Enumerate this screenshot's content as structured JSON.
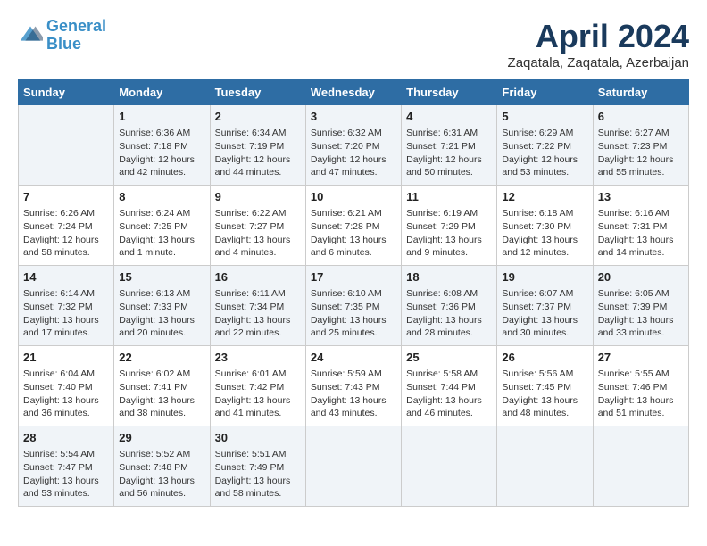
{
  "header": {
    "logo_line1": "General",
    "logo_line2": "Blue",
    "month": "April 2024",
    "location": "Zaqatala, Zaqatala, Azerbaijan"
  },
  "days_of_week": [
    "Sunday",
    "Monday",
    "Tuesday",
    "Wednesday",
    "Thursday",
    "Friday",
    "Saturday"
  ],
  "weeks": [
    [
      {
        "day": "",
        "info": ""
      },
      {
        "day": "1",
        "info": "Sunrise: 6:36 AM\nSunset: 7:18 PM\nDaylight: 12 hours\nand 42 minutes."
      },
      {
        "day": "2",
        "info": "Sunrise: 6:34 AM\nSunset: 7:19 PM\nDaylight: 12 hours\nand 44 minutes."
      },
      {
        "day": "3",
        "info": "Sunrise: 6:32 AM\nSunset: 7:20 PM\nDaylight: 12 hours\nand 47 minutes."
      },
      {
        "day": "4",
        "info": "Sunrise: 6:31 AM\nSunset: 7:21 PM\nDaylight: 12 hours\nand 50 minutes."
      },
      {
        "day": "5",
        "info": "Sunrise: 6:29 AM\nSunset: 7:22 PM\nDaylight: 12 hours\nand 53 minutes."
      },
      {
        "day": "6",
        "info": "Sunrise: 6:27 AM\nSunset: 7:23 PM\nDaylight: 12 hours\nand 55 minutes."
      }
    ],
    [
      {
        "day": "7",
        "info": "Sunrise: 6:26 AM\nSunset: 7:24 PM\nDaylight: 12 hours\nand 58 minutes."
      },
      {
        "day": "8",
        "info": "Sunrise: 6:24 AM\nSunset: 7:25 PM\nDaylight: 13 hours\nand 1 minute."
      },
      {
        "day": "9",
        "info": "Sunrise: 6:22 AM\nSunset: 7:27 PM\nDaylight: 13 hours\nand 4 minutes."
      },
      {
        "day": "10",
        "info": "Sunrise: 6:21 AM\nSunset: 7:28 PM\nDaylight: 13 hours\nand 6 minutes."
      },
      {
        "day": "11",
        "info": "Sunrise: 6:19 AM\nSunset: 7:29 PM\nDaylight: 13 hours\nand 9 minutes."
      },
      {
        "day": "12",
        "info": "Sunrise: 6:18 AM\nSunset: 7:30 PM\nDaylight: 13 hours\nand 12 minutes."
      },
      {
        "day": "13",
        "info": "Sunrise: 6:16 AM\nSunset: 7:31 PM\nDaylight: 13 hours\nand 14 minutes."
      }
    ],
    [
      {
        "day": "14",
        "info": "Sunrise: 6:14 AM\nSunset: 7:32 PM\nDaylight: 13 hours\nand 17 minutes."
      },
      {
        "day": "15",
        "info": "Sunrise: 6:13 AM\nSunset: 7:33 PM\nDaylight: 13 hours\nand 20 minutes."
      },
      {
        "day": "16",
        "info": "Sunrise: 6:11 AM\nSunset: 7:34 PM\nDaylight: 13 hours\nand 22 minutes."
      },
      {
        "day": "17",
        "info": "Sunrise: 6:10 AM\nSunset: 7:35 PM\nDaylight: 13 hours\nand 25 minutes."
      },
      {
        "day": "18",
        "info": "Sunrise: 6:08 AM\nSunset: 7:36 PM\nDaylight: 13 hours\nand 28 minutes."
      },
      {
        "day": "19",
        "info": "Sunrise: 6:07 AM\nSunset: 7:37 PM\nDaylight: 13 hours\nand 30 minutes."
      },
      {
        "day": "20",
        "info": "Sunrise: 6:05 AM\nSunset: 7:39 PM\nDaylight: 13 hours\nand 33 minutes."
      }
    ],
    [
      {
        "day": "21",
        "info": "Sunrise: 6:04 AM\nSunset: 7:40 PM\nDaylight: 13 hours\nand 36 minutes."
      },
      {
        "day": "22",
        "info": "Sunrise: 6:02 AM\nSunset: 7:41 PM\nDaylight: 13 hours\nand 38 minutes."
      },
      {
        "day": "23",
        "info": "Sunrise: 6:01 AM\nSunset: 7:42 PM\nDaylight: 13 hours\nand 41 minutes."
      },
      {
        "day": "24",
        "info": "Sunrise: 5:59 AM\nSunset: 7:43 PM\nDaylight: 13 hours\nand 43 minutes."
      },
      {
        "day": "25",
        "info": "Sunrise: 5:58 AM\nSunset: 7:44 PM\nDaylight: 13 hours\nand 46 minutes."
      },
      {
        "day": "26",
        "info": "Sunrise: 5:56 AM\nSunset: 7:45 PM\nDaylight: 13 hours\nand 48 minutes."
      },
      {
        "day": "27",
        "info": "Sunrise: 5:55 AM\nSunset: 7:46 PM\nDaylight: 13 hours\nand 51 minutes."
      }
    ],
    [
      {
        "day": "28",
        "info": "Sunrise: 5:54 AM\nSunset: 7:47 PM\nDaylight: 13 hours\nand 53 minutes."
      },
      {
        "day": "29",
        "info": "Sunrise: 5:52 AM\nSunset: 7:48 PM\nDaylight: 13 hours\nand 56 minutes."
      },
      {
        "day": "30",
        "info": "Sunrise: 5:51 AM\nSunset: 7:49 PM\nDaylight: 13 hours\nand 58 minutes."
      },
      {
        "day": "",
        "info": ""
      },
      {
        "day": "",
        "info": ""
      },
      {
        "day": "",
        "info": ""
      },
      {
        "day": "",
        "info": ""
      }
    ]
  ]
}
